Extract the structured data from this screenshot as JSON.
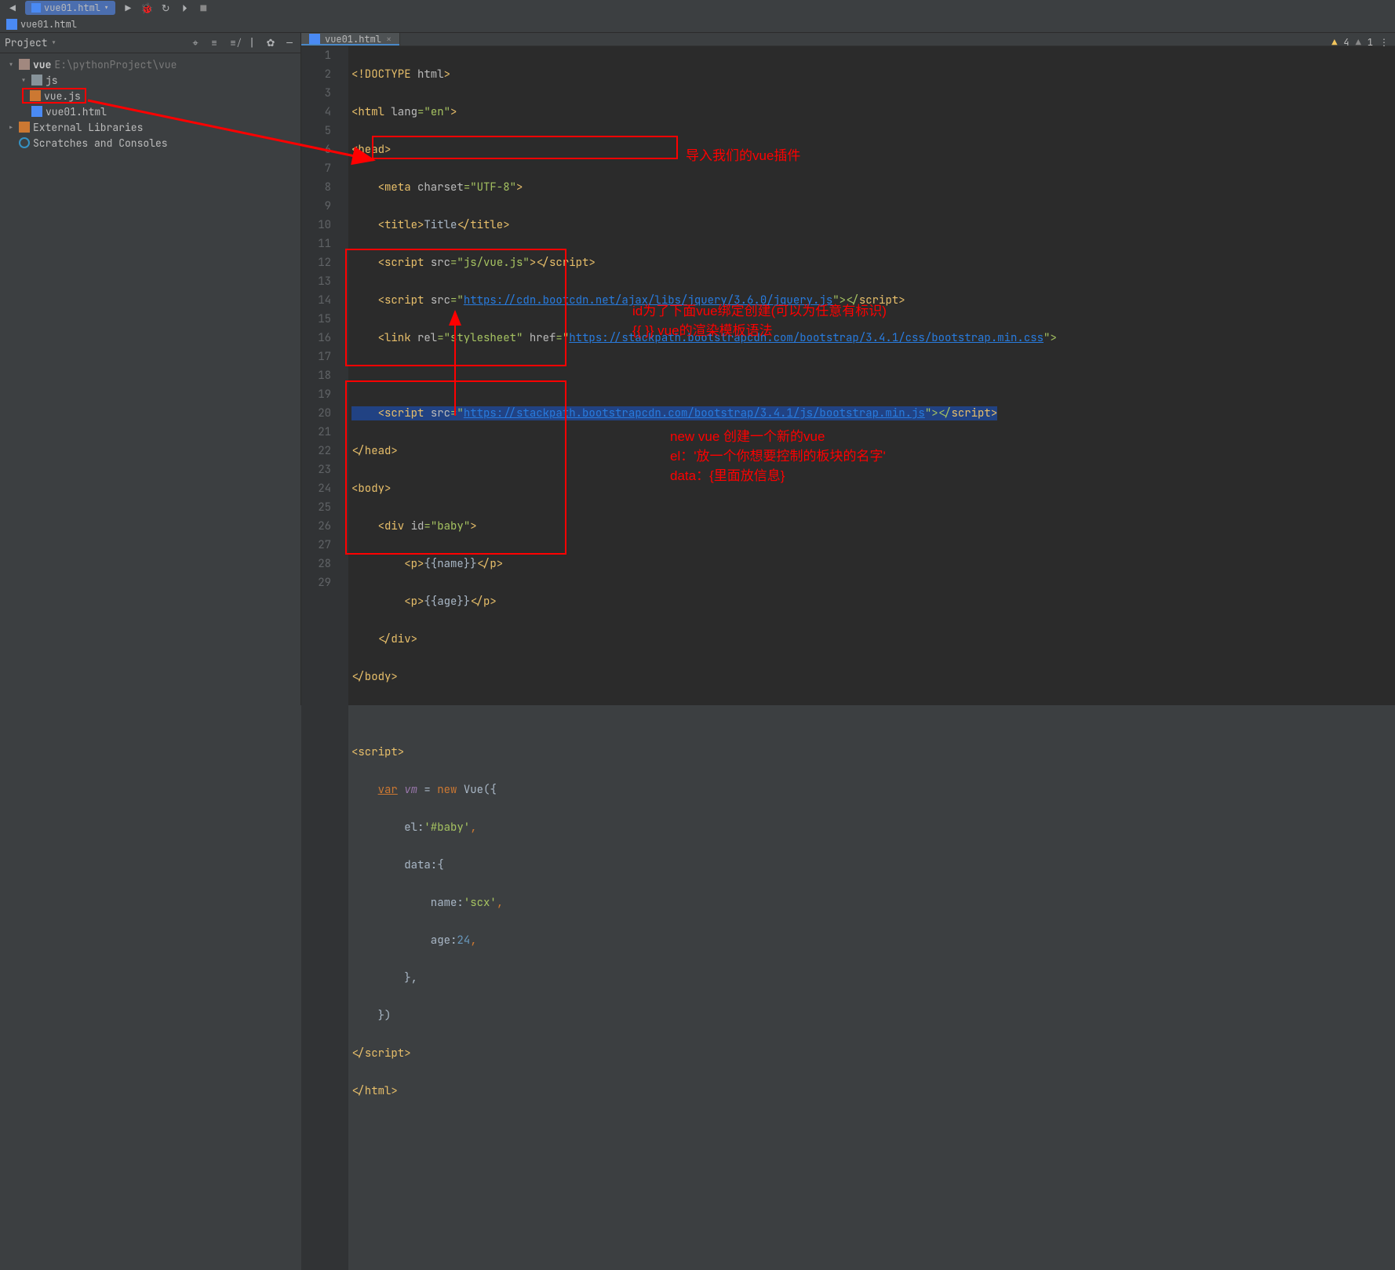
{
  "titlebar": {
    "open_file": "vue01.html"
  },
  "breadcrumb": {
    "file": "vue01.html"
  },
  "projectPanel": {
    "title": "Project",
    "root": {
      "name": "vue",
      "path": "E:\\pythonProject\\vue"
    },
    "jsFolder": "js",
    "jsFile": "vue.js",
    "htmlFile": "vue01.html",
    "externalLibs": "External Libraries",
    "scratches": "Scratches and Consoles"
  },
  "editorTab": {
    "label": "vue01.html"
  },
  "status": {
    "warn4": "4",
    "warn1": "1"
  },
  "lines": [
    "1",
    "2",
    "3",
    "4",
    "5",
    "6",
    "7",
    "8",
    "9",
    "10",
    "11",
    "12",
    "13",
    "14",
    "15",
    "16",
    "17",
    "18",
    "19",
    "20",
    "21",
    "22",
    "23",
    "24",
    "25",
    "26",
    "27",
    "28",
    "29"
  ],
  "code": {
    "l1a": "<!DOCTYPE ",
    "l1b": "html",
    "l1c": ">",
    "l2a": "<html ",
    "l2b": "lang",
    "l2c": "=\"en\"",
    "l2d": ">",
    "l3": "<head>",
    "l4a": "    <meta ",
    "l4b": "charset",
    "l4c": "=\"UTF-8\"",
    "l4d": ">",
    "l5a": "    <title>",
    "l5b": "Title",
    "l5c": "</title>",
    "l6a": "    <script ",
    "l6b": "src",
    "l6c": "=\"js/vue.js\"",
    "l6d": "></",
    "l6d2": "script",
    "l6e": ">",
    "l7a": "    <script ",
    "l7b": "src",
    "l7c": "=\"",
    "l7url": "https://cdn.bootcdn.net/ajax/libs/jquery/3.6.0/jquery.js",
    "l7d": "\"></",
    "l7d2": "script",
    "l7e": ">",
    "l8a": "    <link ",
    "l8b": "rel",
    "l8c": "=\"stylesheet\" ",
    "l8d": "href",
    "l8e": "=\"",
    "l8url": "https://stackpath.bootstrapcdn.com/bootstrap/3.4.1/css/bootstrap.min.css",
    "l8f": "\">",
    "l10a": "    <script ",
    "l10b": "src",
    "l10c": "=\"",
    "l10url": "https://stackpath.bootstrapcdn.com/bootstrap/3.4.1/js/bootstrap.min.js",
    "l10d": "\"></",
    "l10d2": "script",
    "l10e": ">",
    "l11": "</head>",
    "l12": "<body>",
    "l13a": "    <div ",
    "l13b": "id",
    "l13c": "=\"baby\"",
    "l13d": ">",
    "l14a": "        <p>",
    "l14b": "{{name}}",
    "l14c": "</p>",
    "l15a": "        <p>",
    "l15b": "{{age}}",
    "l15c": "</p>",
    "l16": "    </div>",
    "l17": "</body>",
    "l19": "<script>",
    "l20a": "    ",
    "l20var": "var",
    "l20b": " vm ",
    "l20c": "= ",
    "l20new": "new ",
    "l20d": "Vue({",
    "l21a": "        el:",
    "l21b": "'#baby'",
    "l21c": ",",
    "l22": "        data:{",
    "l23a": "            name:",
    "l23b": "'scx'",
    "l23c": ",",
    "l24a": "            age:",
    "l24b": "24",
    "l24c": ",",
    "l25": "        },",
    "l26": "    })",
    "l27a": "</",
    "l27b": "script",
    "l27c": ">",
    "l28": "</html>"
  },
  "annotations": {
    "a1": "导入我们的vue插件",
    "a2a": "id为了下面vue绑定创建(可以为任意有标识)",
    "a2b": "{{ }} vue的渲染模板语法",
    "a3a": "new vue 创建一个新的vue",
    "a3b": "el：'放一个你想要控制的板块的名字'",
    "a3c": "data：{里面放信息}"
  }
}
